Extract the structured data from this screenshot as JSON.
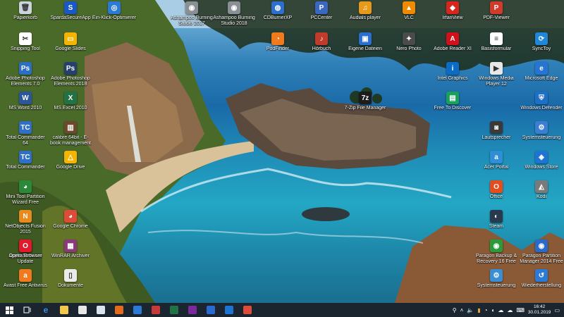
{
  "desktop": {
    "icons": [
      {
        "label": "Papierkorb",
        "icon": "recycle-bin-icon",
        "color": "#c9d4dc",
        "glyph": "🗑"
      },
      {
        "label": "SpardaSecureApp",
        "icon": "sparda-icon",
        "color": "#1a58c8",
        "glyph": "S"
      },
      {
        "label": "Ein-Klick-Optimierer",
        "icon": "optimizer-icon",
        "color": "#2a7ad6",
        "glyph": "◎"
      },
      {
        "label": "Ashampoo Burning Studio 2017",
        "icon": "ashampoo-icon",
        "color": "#8a8f96",
        "glyph": "◉"
      },
      {
        "label": "Ashampoo Burning Studio 2018",
        "icon": "ashampoo-icon",
        "color": "#8a8f96",
        "glyph": "◉"
      },
      {
        "label": "CDBurnerXP",
        "icon": "cdburner-icon",
        "color": "#2d6fcf",
        "glyph": "◍"
      },
      {
        "label": "PCCenter",
        "icon": "pccenter-icon",
        "color": "#3a66c4",
        "glyph": "P"
      },
      {
        "label": "Audials player",
        "icon": "audials-icon",
        "color": "#e79a1a",
        "glyph": "♫"
      },
      {
        "label": "VLC",
        "icon": "vlc-icon",
        "color": "#f08a00",
        "glyph": "▲"
      },
      {
        "label": "IrfanView",
        "icon": "irfanview-icon",
        "color": "#d8261c",
        "glyph": "◆"
      },
      {
        "label": "PDF-Viewer",
        "icon": "pdf-viewer-icon",
        "color": "#d23a2a",
        "glyph": "P"
      },
      {
        "label": "Snipping Tool",
        "icon": "scissors-icon",
        "color": "#ffffff",
        "glyph": "✂"
      },
      {
        "label": "Google Slides",
        "icon": "slides-icon",
        "color": "#f4b400",
        "glyph": "▭"
      },
      {
        "label": "PodFinder",
        "icon": "rss-icon",
        "color": "#f07a1c",
        "glyph": "◔"
      },
      {
        "label": "Hörbuch",
        "icon": "audiobook-icon",
        "color": "#c23a2a",
        "glyph": "♪"
      },
      {
        "label": "Eigene Dateien",
        "icon": "folder-icon",
        "color": "#2a6fd0",
        "glyph": "▣"
      },
      {
        "label": "Nero Photo",
        "icon": "nero-icon",
        "color": "#4b4b4b",
        "glyph": "✦"
      },
      {
        "label": "Adobe Reader XI",
        "icon": "adobe-reader-icon",
        "color": "#d1101a",
        "glyph": "A"
      },
      {
        "label": "Basisformular",
        "icon": "form-icon",
        "color": "#ffffff",
        "glyph": "≡"
      },
      {
        "label": "SyncToy",
        "icon": "sync-icon",
        "color": "#1f86d8",
        "glyph": "⟳"
      },
      {
        "label": "Adobe Photoshop Elements 7.0",
        "icon": "photoshop-elements-icon",
        "color": "#2b6fc4",
        "glyph": "Ps"
      },
      {
        "label": "Adobe Photoshop Elements 2018",
        "icon": "photoshop-elements-icon",
        "color": "#26406e",
        "glyph": "Ps"
      },
      {
        "label": "Intel Graphics",
        "icon": "intel-icon",
        "color": "#0a6cc4",
        "glyph": "i"
      },
      {
        "label": "Windows Media Player 12",
        "icon": "media-player-icon",
        "color": "#e7e7e7",
        "glyph": "▶"
      },
      {
        "label": "Microsoft Edge",
        "icon": "edge-icon",
        "color": "#2775d2",
        "glyph": "e"
      },
      {
        "label": "MS Word 2010",
        "icon": "word-icon",
        "color": "#2b579a",
        "glyph": "W"
      },
      {
        "label": "MS Excel 2010",
        "icon": "excel-icon",
        "color": "#217346",
        "glyph": "X"
      },
      {
        "label": "7-Zip File Manager",
        "icon": "7zip-icon",
        "color": "#1c1c1c",
        "glyph": "7z"
      },
      {
        "label": "Free To Discover",
        "icon": "app-icon",
        "color": "#1aa05a",
        "glyph": "▤"
      },
      {
        "label": "Windows Defender",
        "icon": "shield-icon",
        "color": "#1e6fc8",
        "glyph": "⛨"
      },
      {
        "label": "Total Commander 64",
        "icon": "total-commander-icon",
        "color": "#2f6fc6",
        "glyph": "TC"
      },
      {
        "label": "calibre 64bit - E-book management",
        "icon": "calibre-icon",
        "color": "#6a4a2a",
        "glyph": "▥"
      },
      {
        "label": "Lautsprecher",
        "icon": "speaker-icon",
        "color": "#3a3a3a",
        "glyph": "◙"
      },
      {
        "label": "Systemsteuerung",
        "icon": "control-panel-icon",
        "color": "#3a7fd4",
        "glyph": "⚙"
      },
      {
        "label": "Total Commander",
        "icon": "total-commander-icon",
        "color": "#2f6fc6",
        "glyph": "TC"
      },
      {
        "label": "Google Drive",
        "icon": "google-drive-icon",
        "color": "#f4b400",
        "glyph": "△"
      },
      {
        "label": "Acer Portal",
        "icon": "acer-icon",
        "color": "#2e8fd8",
        "glyph": "a"
      },
      {
        "label": "Windows Store",
        "icon": "store-icon",
        "color": "#1e74d2",
        "glyph": "◈"
      },
      {
        "label": "Mini Tool Partition Wizard Free",
        "icon": "partition-icon",
        "color": "#2a8a3a",
        "glyph": "◕"
      },
      {
        "label": "Office",
        "icon": "office-icon",
        "color": "#e74c1c",
        "glyph": "O"
      },
      {
        "label": "Kodi",
        "icon": "kodi-icon",
        "color": "#7a7a7a",
        "glyph": "◭"
      },
      {
        "label": "NetObjects Fusion 2015",
        "icon": "netobjects-icon",
        "color": "#e88a1c",
        "glyph": "N"
      },
      {
        "label": "Google Chrome",
        "icon": "chrome-icon",
        "color": "#dd4b39",
        "glyph": "◕"
      },
      {
        "label": "Steam",
        "icon": "steam-icon",
        "color": "#2a3a4e",
        "glyph": "◐"
      },
      {
        "label": "Apple Software Update",
        "icon": "apple-update-icon",
        "color": "#3a3a3a",
        "glyph": "◒"
      },
      {
        "label": "Opera Browser",
        "icon": "opera-icon",
        "color": "#e01a2a",
        "glyph": "O"
      },
      {
        "label": "WinRAR Archiver",
        "icon": "winrar-icon",
        "color": "#8a3a7a",
        "glyph": "▦"
      },
      {
        "label": "Paragon Backup & Recovery 16 Free",
        "icon": "paragon-icon",
        "color": "#2a9a3a",
        "glyph": "◉"
      },
      {
        "label": "Paragon Partition Manager 2014 Free",
        "icon": "paragon-icon",
        "color": "#2a6aca",
        "glyph": "◉"
      },
      {
        "label": "Avast Free Antivirus",
        "icon": "avast-icon",
        "color": "#f07a1c",
        "glyph": "a"
      },
      {
        "label": "Dokumente",
        "icon": "document-icon",
        "color": "#eaeaea",
        "glyph": "▯"
      },
      {
        "label": "Systemsteuerung",
        "icon": "control-panel-icon",
        "color": "#3a8fd4",
        "glyph": "⚙"
      },
      {
        "label": "Wiederherstellung",
        "icon": "restore-icon",
        "color": "#2a7ad6",
        "glyph": "↺"
      }
    ]
  },
  "taskbar": {
    "apps": [
      {
        "name": "file-explorer",
        "icon": "folder-icon",
        "color": "#f2c94c"
      },
      {
        "name": "store",
        "icon": "store-icon",
        "color": "#e8e8e8"
      },
      {
        "name": "notepad",
        "icon": "notepad-icon",
        "color": "#d9e6f2"
      },
      {
        "name": "firefox",
        "icon": "firefox-icon",
        "color": "#e66a1c"
      },
      {
        "name": "mail",
        "icon": "mail-icon",
        "color": "#2a7ad6"
      },
      {
        "name": "photos",
        "icon": "photos-icon",
        "color": "#c83a3a"
      },
      {
        "name": "excel",
        "icon": "excel-icon",
        "color": "#217346"
      },
      {
        "name": "onenote",
        "icon": "onenote-icon",
        "color": "#7a2a9a"
      },
      {
        "name": "save",
        "icon": "save-icon",
        "color": "#2a6ad0"
      },
      {
        "name": "outlook",
        "icon": "outlook-icon",
        "color": "#1e74d2"
      },
      {
        "name": "chrome",
        "icon": "chrome-icon",
        "color": "#dd4b39"
      }
    ],
    "tray": {
      "time": "16:42",
      "date": "30.01.2019"
    }
  }
}
